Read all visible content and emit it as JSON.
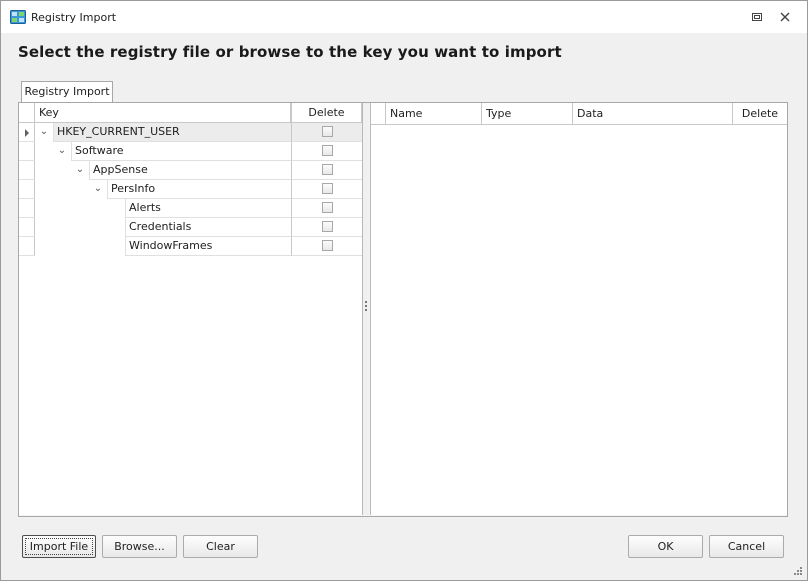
{
  "window": {
    "title": "Registry Import",
    "icon": "registry-icon",
    "controls": [
      "restore-icon",
      "close-icon"
    ]
  },
  "heading": "Select the registry file or browse to the key you want to import",
  "tab": {
    "label": "Registry Import"
  },
  "tree": {
    "columns": {
      "key": "Key",
      "delete": "Delete"
    },
    "rows": [
      {
        "label": "HKEY_CURRENT_USER",
        "level": 0,
        "expanded": true,
        "focused": true,
        "delete": false
      },
      {
        "label": "Software",
        "level": 1,
        "expanded": true,
        "delete": false
      },
      {
        "label": "AppSense",
        "level": 2,
        "expanded": true,
        "delete": false
      },
      {
        "label": "PersInfo",
        "level": 3,
        "expanded": true,
        "delete": false
      },
      {
        "label": "Alerts",
        "level": 4,
        "expanded": false,
        "delete": false
      },
      {
        "label": "Credentials",
        "level": 4,
        "expanded": false,
        "delete": false
      },
      {
        "label": "WindowFrames",
        "level": 4,
        "expanded": false,
        "delete": false
      }
    ]
  },
  "values_grid": {
    "columns": {
      "name": "Name",
      "type": "Type",
      "data": "Data",
      "delete": "Delete"
    },
    "rows": []
  },
  "buttons": {
    "import_file": "Import File",
    "browse": "Browse...",
    "clear": "Clear",
    "ok": "OK",
    "cancel": "Cancel"
  },
  "colors": {
    "accent": "#2e7fd1",
    "border": "#a7a7a7",
    "background": "#f0f0f0"
  }
}
